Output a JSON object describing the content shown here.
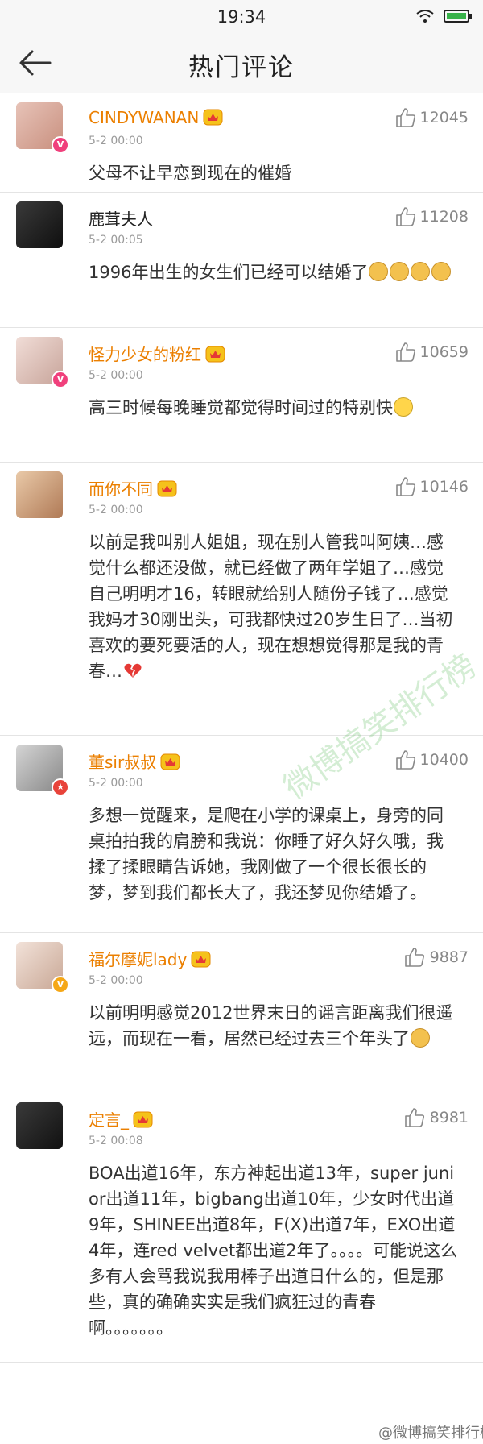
{
  "status_bar": {
    "time": "19:34"
  },
  "header": {
    "title": "热门评论"
  },
  "comments": [
    {
      "user": "CINDYWANAN",
      "vip": true,
      "likes": "12045",
      "time": "5-2 00:00",
      "text": "父母不让早恋到现在的催婚"
    },
    {
      "user": "鹿茸夫人",
      "vip": false,
      "likes": "11208",
      "time": "5-2 00:05",
      "text": "1996年出生的女生们已经可以结婚了"
    },
    {
      "user": "怪力少女的粉红",
      "vip": true,
      "likes": "10659",
      "time": "5-2 00:00",
      "text": "高三时候每晚睡觉都觉得时间过的特别快"
    },
    {
      "user": "而你不同",
      "vip": true,
      "likes": "10146",
      "time": "5-2 00:00",
      "text": "以前是我叫别人姐姐，现在别人管我叫阿姨…感觉什么都还没做，就已经做了两年学姐了…感觉自己明明才16，转眼就给别人随份子钱了…感觉我妈才30刚出头，可我都快过20岁生日了…当初喜欢的要死要活的人，现在想想觉得那是我的青春…"
    },
    {
      "user": "董sir叔叔",
      "vip": true,
      "likes": "10400",
      "time": "5-2 00:00",
      "text": "多想一觉醒来，是爬在小学的课桌上，身旁的同桌拍拍我的肩膀和我说：你睡了好久好久哦，我揉了揉眼睛告诉她，我刚做了一个很长很长的梦，梦到我们都长大了，我还梦见你结婚了。"
    },
    {
      "user": "福尔摩妮lady",
      "vip": true,
      "likes": "9887",
      "time": "5-2 00:00",
      "text": "以前明明感觉2012世界末日的谣言距离我们很遥远，而现在一看，居然已经过去三个年头了"
    },
    {
      "user": "定言_",
      "vip": true,
      "likes": "8981",
      "time": "5-2 00:08",
      "text": "BOA出道16年，东方神起出道13年，super junior出道11年，bigbang出道10年，少女时代出道9年，SHINEE出道8年，F(X)出道7年，EXO出道4年，连red velvet都出道2年了。。。。可能说这么多有人会骂我说我用棒子出道日什么的，但是那些，真的确确实实是我们疯狂过的青春啊。。。。。。。"
    }
  ],
  "watermark": {
    "diagonal": "微博搞笑排行榜",
    "corner": "@微博搞笑排行榜"
  },
  "colors": {
    "username_orange": "#eb7f00",
    "bar_background": "#f7f7f7"
  },
  "icons": [
    "wifi-icon",
    "battery-icon",
    "back-arrow-icon",
    "thumbs-up-icon",
    "vip-crown-icon",
    "verified-badge-icon"
  ]
}
